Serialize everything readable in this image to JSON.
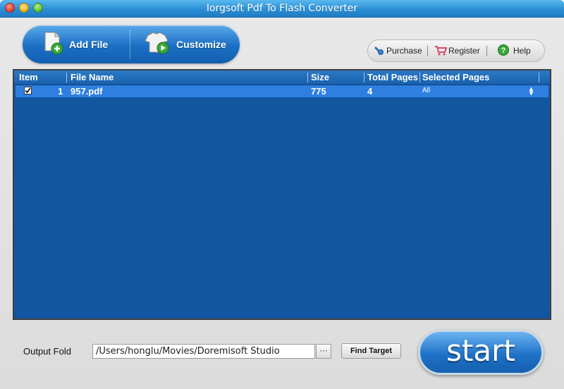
{
  "window": {
    "title": "Iorgsoft Pdf To Flash Converter"
  },
  "toolbar": {
    "add_file": "Add File",
    "customize": "Customize"
  },
  "links": {
    "purchase": "Purchase",
    "register": "Register",
    "help": "Help"
  },
  "table": {
    "columns": [
      "Item",
      "File Name",
      "Size",
      "Total Pages",
      "Selected Pages"
    ],
    "rows": [
      {
        "checked": true,
        "item": "1",
        "file_name": "957.pdf",
        "size": "775",
        "total_pages": "4",
        "selected_pages": "All"
      }
    ]
  },
  "output": {
    "label": "Output Fold",
    "path": "/Users/honglu/Movies/Doremisoft Studio",
    "browse": "···",
    "find_target": "Find Target"
  },
  "start": {
    "label": "start"
  },
  "colors": {
    "accent": "#1a6fc4",
    "table_bg": "#1256a0",
    "row_selected": "#2f7fe0"
  }
}
